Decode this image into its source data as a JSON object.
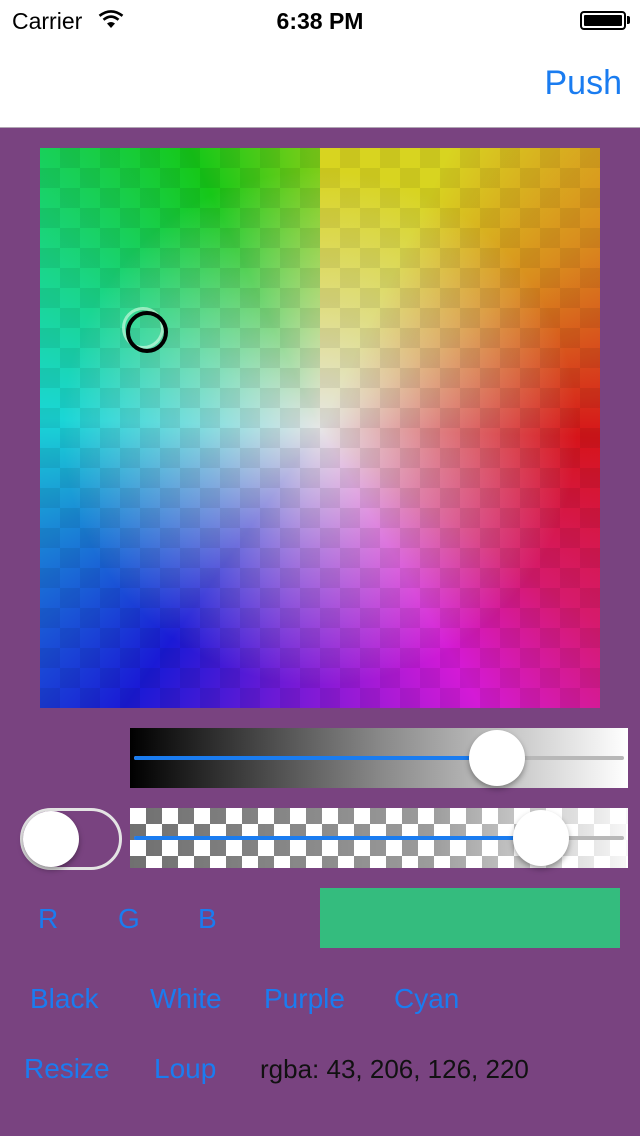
{
  "status_bar": {
    "carrier": "Carrier",
    "time": "6:38 PM",
    "wifi_icon": "wifi-icon",
    "battery_icon": "battery-icon",
    "battery_level": 1.0
  },
  "nav": {
    "push_label": "Push"
  },
  "color_wheel": {
    "selected_hue_saturation_marker": "picker-ring"
  },
  "brightness_slider": {
    "value": 0.74
  },
  "alpha_slider": {
    "value": 0.83
  },
  "toggle": {
    "on": false
  },
  "channel_buttons": [
    "R",
    "G",
    "B"
  ],
  "preview": {
    "color": "#34bc7e"
  },
  "preset_buttons": [
    "Black",
    "White",
    "Purple",
    "Cyan"
  ],
  "action_buttons": [
    "Resize",
    "Loup"
  ],
  "rgba_readout": "rgba: 43, 206, 126, 220",
  "colors": {
    "accent": "#1a7cf0",
    "background": "#794380"
  }
}
